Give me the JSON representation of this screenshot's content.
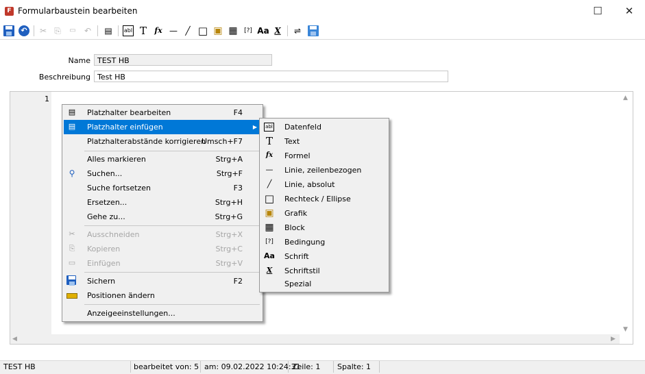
{
  "window": {
    "title": "Formularbaustein bearbeiten",
    "app_icon_glyph": "F"
  },
  "toolbar": {
    "items": [
      {
        "name": "save-icon"
      },
      {
        "name": "undo-icon"
      },
      {
        "name": "cut-icon",
        "glyph": "✂"
      },
      {
        "name": "copy-icon",
        "glyph": "⎘"
      },
      {
        "name": "paste-icon",
        "glyph": "📋"
      },
      {
        "name": "redo-icon",
        "glyph": "↶"
      },
      {
        "name": "placeholder-edit-icon",
        "glyph": "▤"
      },
      {
        "name": "datafield-icon",
        "glyph": "abl"
      },
      {
        "name": "text-icon",
        "glyph": "T"
      },
      {
        "name": "formula-icon",
        "glyph": "fx"
      },
      {
        "name": "line-row-icon",
        "glyph": "—"
      },
      {
        "name": "line-absolute-icon",
        "glyph": "╱"
      },
      {
        "name": "rectangle-icon",
        "glyph": "□"
      },
      {
        "name": "image-icon",
        "glyph": "▣"
      },
      {
        "name": "block-icon",
        "glyph": "▦"
      },
      {
        "name": "condition-icon",
        "glyph": "[?]"
      },
      {
        "name": "font-icon",
        "glyph": "Aa"
      },
      {
        "name": "fontstyle-icon",
        "glyph": "X"
      },
      {
        "name": "wrap-icon",
        "glyph": "⇌"
      },
      {
        "name": "save-as-icon"
      }
    ]
  },
  "form": {
    "name_label": "Name",
    "name_value": "TEST HB",
    "description_label": "Beschreibung",
    "description_value": "Test HB"
  },
  "editor": {
    "line_number": "1"
  },
  "context_menu": {
    "items": [
      {
        "label": "Platzhalter bearbeiten",
        "shortcut": "F4",
        "icon": "placeholder-edit-icon",
        "glyph": "▤"
      },
      {
        "label": "Platzhalter einfügen",
        "shortcut": "",
        "icon": "placeholder-insert-icon",
        "glyph": "▤",
        "highlighted": true,
        "submenu": true
      },
      {
        "label": "Platzhalterabstände korrigieren",
        "shortcut": "Umsch+F7"
      },
      {
        "label": "Alles markieren",
        "shortcut": "Strg+A"
      },
      {
        "label": "Suchen...",
        "shortcut": "Strg+F",
        "icon": "search-icon",
        "glyph": "🔍"
      },
      {
        "label": "Suche fortsetzen",
        "shortcut": "F3"
      },
      {
        "label": "Ersetzen...",
        "shortcut": "Strg+H"
      },
      {
        "label": "Gehe zu...",
        "shortcut": "Strg+G"
      },
      {
        "label": "Ausschneiden",
        "shortcut": "Strg+X",
        "disabled": true,
        "icon": "cut-icon",
        "glyph": "✂"
      },
      {
        "label": "Kopieren",
        "shortcut": "Strg+C",
        "disabled": true,
        "icon": "copy-icon",
        "glyph": "⎘"
      },
      {
        "label": "Einfügen",
        "shortcut": "Strg+V",
        "disabled": true,
        "icon": "paste-icon",
        "glyph": "▭"
      },
      {
        "label": "Sichern",
        "shortcut": "F2",
        "icon": "save-icon"
      },
      {
        "label": "Positionen ändern",
        "shortcut": "",
        "icon": "ruler-icon"
      },
      {
        "label": "Anzeigeeinstellungen...",
        "shortcut": ""
      }
    ]
  },
  "submenu": {
    "items": [
      {
        "label": "Datenfeld",
        "icon": "datafield-icon",
        "glyph": "abl"
      },
      {
        "label": "Text",
        "icon": "text-icon",
        "glyph": "T"
      },
      {
        "label": "Formel",
        "icon": "formula-icon",
        "glyph": "fx"
      },
      {
        "label": "Linie, zeilenbezogen",
        "icon": "line-row-icon",
        "glyph": "—"
      },
      {
        "label": "Linie, absolut",
        "icon": "line-absolute-icon",
        "glyph": "╱"
      },
      {
        "label": "Rechteck / Ellipse",
        "icon": "rectangle-icon",
        "glyph": "□"
      },
      {
        "label": "Grafik",
        "icon": "image-icon",
        "glyph": "▣"
      },
      {
        "label": "Block",
        "icon": "block-icon",
        "glyph": "▦"
      },
      {
        "label": "Bedingung",
        "icon": "condition-icon",
        "glyph": "[?]"
      },
      {
        "label": "Schrift",
        "icon": "font-icon",
        "glyph": "Aa"
      },
      {
        "label": "Schriftstil",
        "icon": "fontstyle-icon",
        "glyph": "X"
      },
      {
        "label": "Spezial",
        "icon": "",
        "glyph": ""
      }
    ]
  },
  "statusbar": {
    "name": "TEST HB",
    "edited_by": "bearbeitet von:  5",
    "date": "am: 09.02.2022 10:24:31",
    "line": "Zeile: 1",
    "column": "Spalte: 1"
  },
  "colors": {
    "highlight": "#0078d7",
    "menu_bg": "#f0f0f0",
    "icon_blue": "#1f5fbf"
  }
}
